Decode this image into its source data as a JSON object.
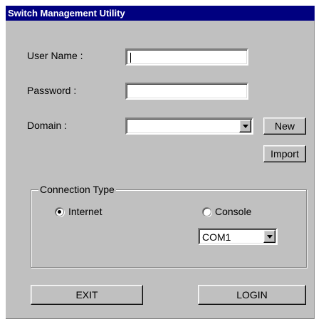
{
  "window": {
    "title": "Switch Management Utility"
  },
  "login_form": {
    "username_label": "User Name :",
    "username_value": "",
    "password_label": "Password :",
    "password_value": "",
    "domain_label": "Domain :",
    "domain_value": ""
  },
  "buttons": {
    "new_label": "New",
    "import_label": "Import",
    "exit_label": "EXIT",
    "login_label": "LOGIN"
  },
  "connection_type": {
    "legend": "Connection Type",
    "internet_label": "Internet",
    "console_label": "Console",
    "selected": "Internet",
    "port_value": "COM1"
  },
  "icons": {
    "dropdown_arrow": "chevron-down-icon",
    "radio": "radio-button"
  },
  "colors": {
    "titlebar": "#000080",
    "face": "#c0c0c0"
  }
}
